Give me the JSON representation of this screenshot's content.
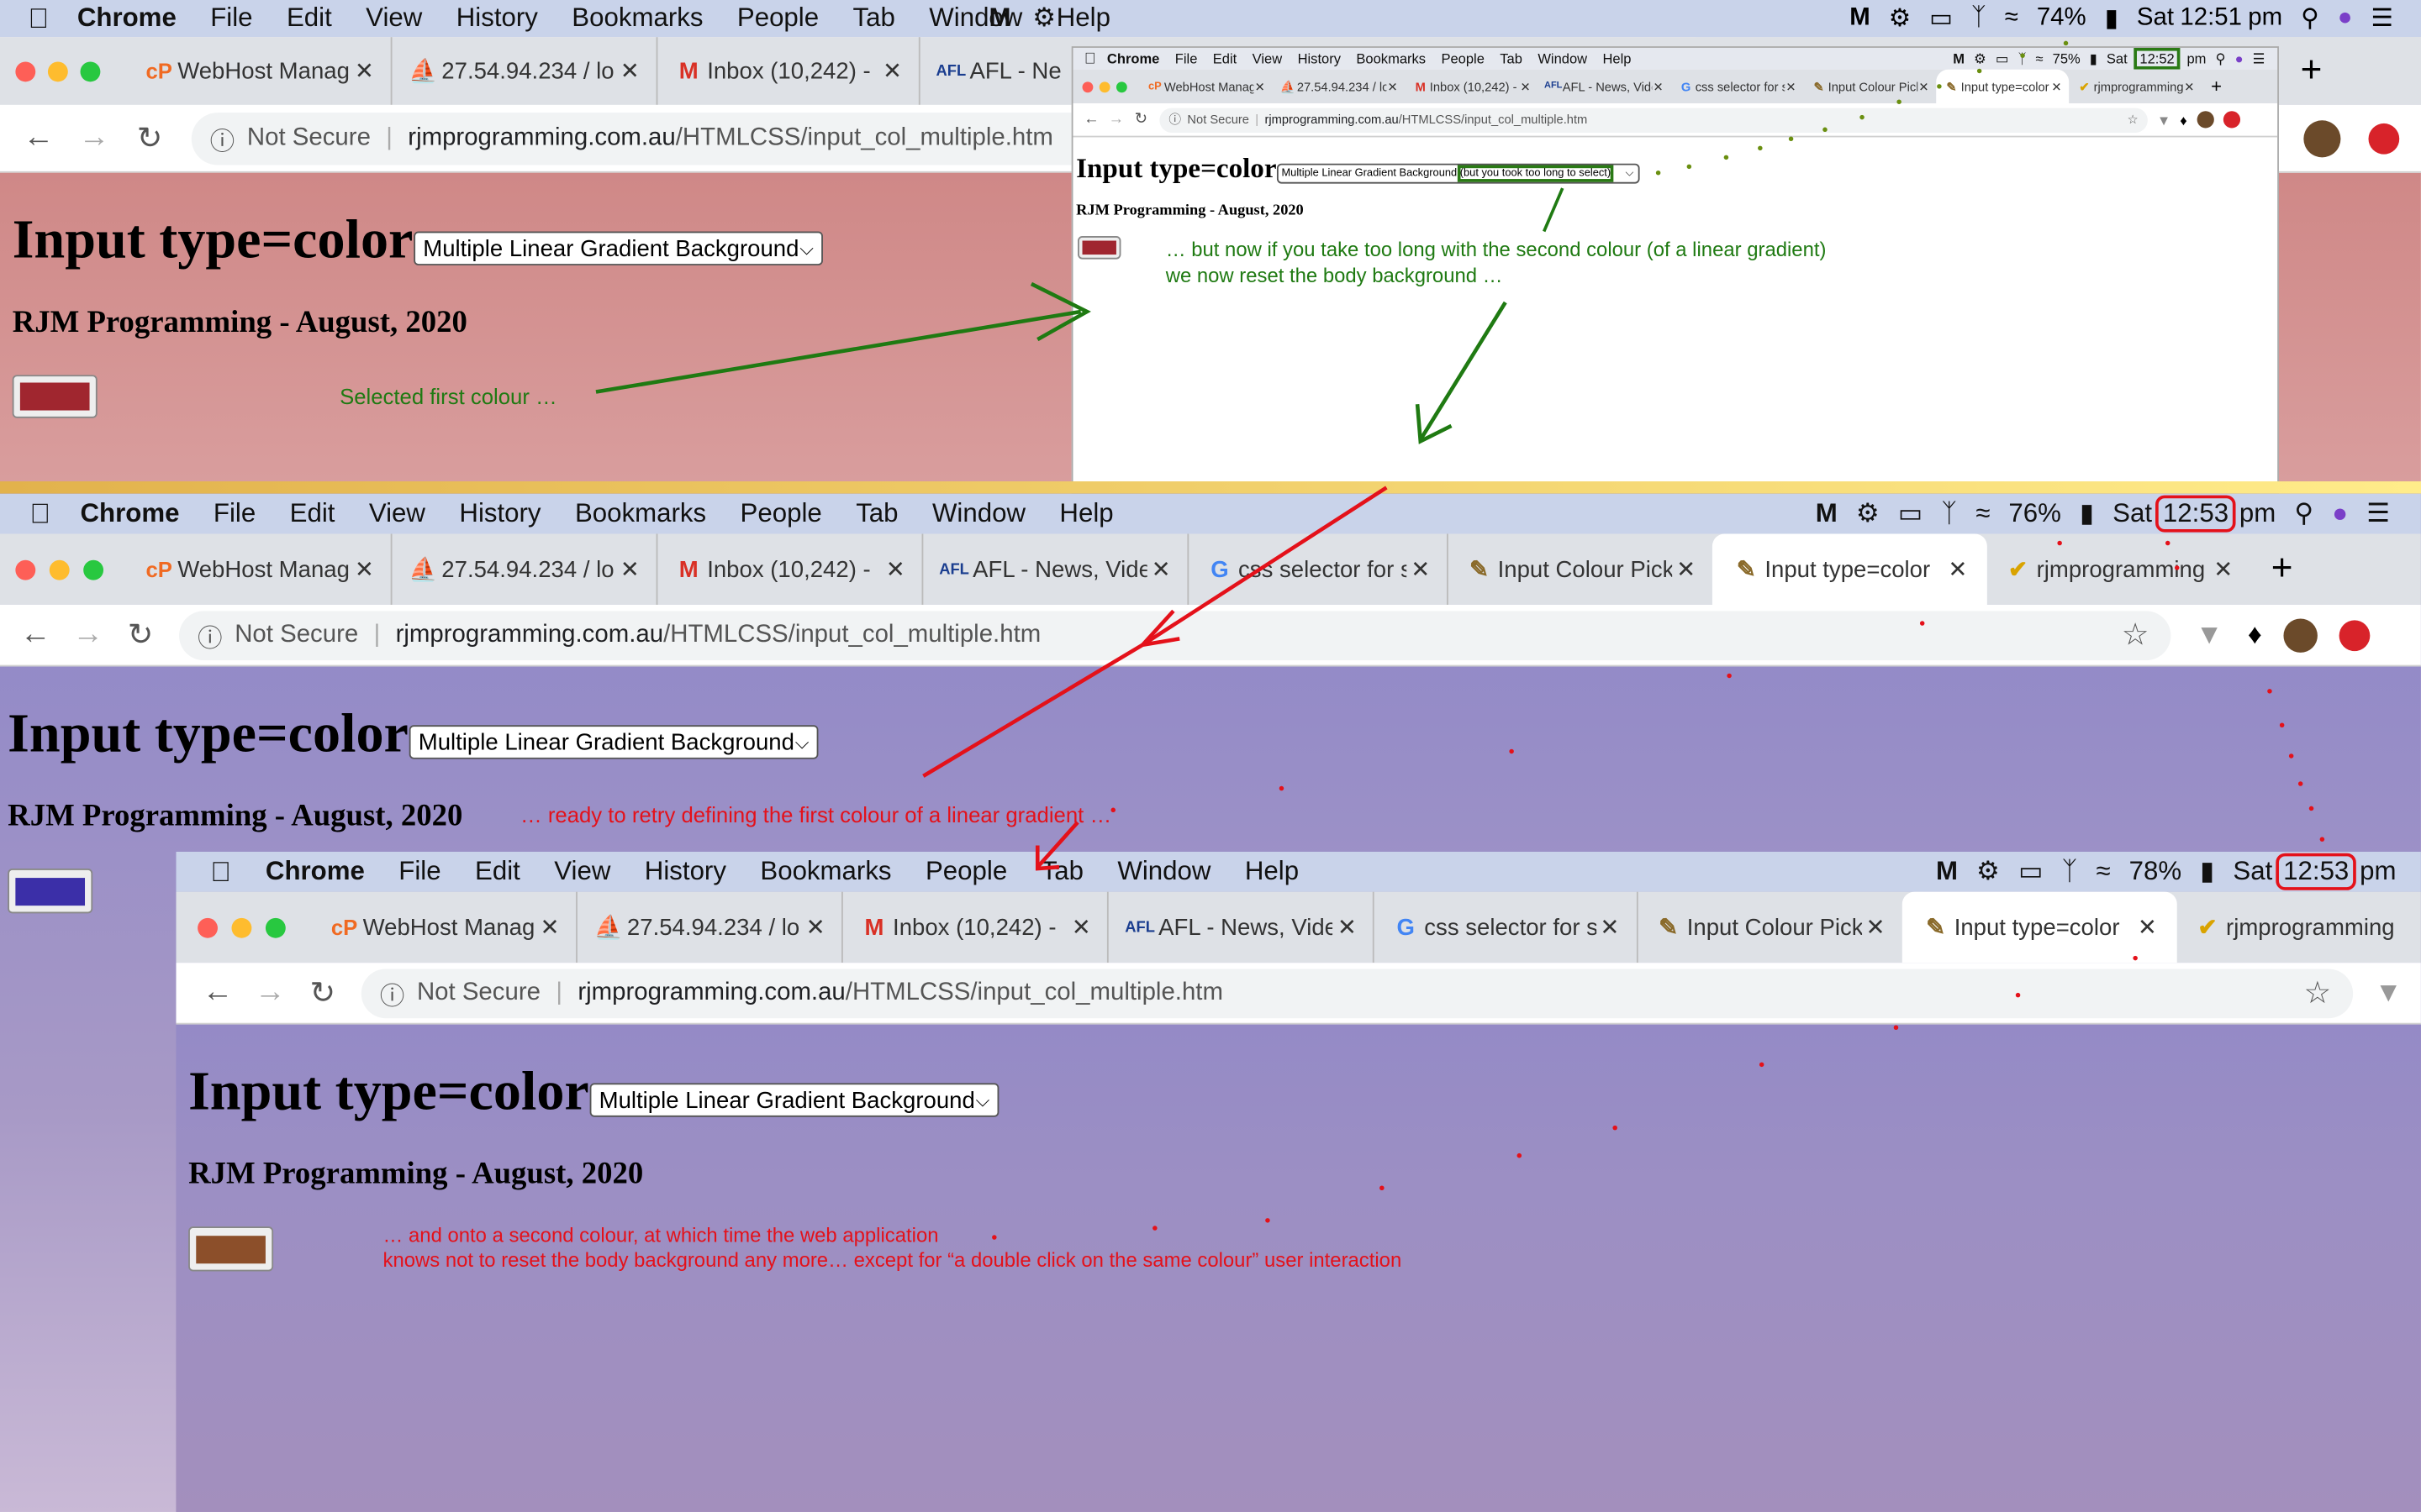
{
  "menu": {
    "app": "Chrome",
    "items": [
      "File",
      "Edit",
      "View",
      "History",
      "Bookmarks",
      "People",
      "Tab",
      "Window",
      "Help"
    ]
  },
  "shots": [
    {
      "battery": "74%",
      "day": "Sat",
      "time": "12:51",
      "ampm": "pm",
      "url_domain": "rjmprogramming.com.au",
      "url_path": "/HTMLCSS/input_col_multiple.htm"
    },
    {
      "battery": "75%",
      "day": "Sat",
      "time": "12:52",
      "ampm": "pm"
    },
    {
      "battery": "76%",
      "day": "Sat",
      "time": "12:53",
      "ampm": "pm"
    },
    {
      "battery": "78%",
      "day": "Sat",
      "time": "12:53",
      "ampm": "pm"
    }
  ],
  "tabs": [
    {
      "title": "WebHost Manag",
      "icon": "cP"
    },
    {
      "title": "27.54.94.234 / lo",
      "icon": "img"
    },
    {
      "title": "Inbox (10,242) -",
      "icon": "M"
    },
    {
      "title": "AFL - News, Vide",
      "icon": "AFL"
    },
    {
      "title": "css selector for s",
      "icon": "G"
    },
    {
      "title": "Input Colour Pick",
      "icon": "img"
    },
    {
      "title": "Input type=color",
      "icon": "img"
    },
    {
      "title": "rjmprogramming",
      "icon": "check"
    }
  ],
  "browser": {
    "not_secure": "Not Secure",
    "url_domain": "rjmprogramming.com.au",
    "url_path": "/HTMLCSS/input_col_multiple.htm"
  },
  "page": {
    "heading": "Input type=color",
    "select_value": "Multiple Linear Gradient Background",
    "select_value_timeout": "(but you took too long to select)",
    "subheading": "RJM Programming - August, 2020"
  },
  "colors": {
    "first": "#a0262f",
    "retry": "#3b2fa8",
    "second": "#8c4f2a",
    "green_note": "#1f7a12",
    "red_note": "#e4111a"
  },
  "annotations": {
    "selected_first": "Selected first colour …",
    "timeout_line1": "… but now if you take too long with the second colour (of a linear gradient)",
    "timeout_line2": "we now reset the body background …",
    "retry": "… ready to retry defining the first colour of a linear gradient …",
    "second_line1": "… and onto a second colour, at which time the web application",
    "second_line2": "knows not to reset the body background any more… except for “a double click on the same colour” user interaction"
  }
}
